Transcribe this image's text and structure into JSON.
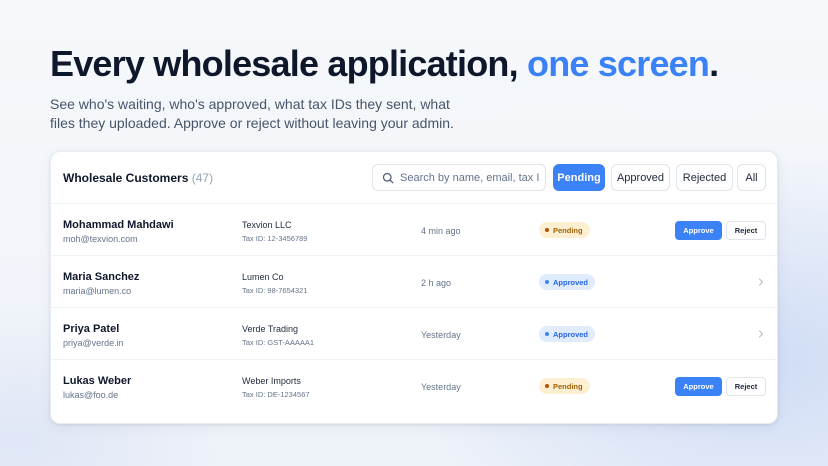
{
  "hero": {
    "title_main": "Every wholesale application, ",
    "title_accent": "one screen",
    "title_end": ".",
    "subtitle": "See who's waiting, who's approved, what tax IDs they sent, what files they uploaded. Approve or reject without leaving your admin.",
    "accent_color": "#3b82f6"
  },
  "panel": {
    "title": "Wholesale Customers",
    "count": "(47)",
    "search": {
      "placeholder": "Search by name, email, tax ID...",
      "value": "",
      "icon": "search-icon"
    },
    "filters": [
      {
        "label": "Pending",
        "active": true
      },
      {
        "label": "Approved",
        "active": false
      },
      {
        "label": "Rejected",
        "active": false
      },
      {
        "label": "All",
        "active": false
      }
    ]
  },
  "customers": [
    {
      "name": "Mohammad Mahdawi",
      "email": "moh@texvion.com",
      "company": "Texvion LLC",
      "tax_id": "Tax ID: 12-3456789",
      "time": "4 min ago",
      "status": "Pending",
      "actions": {
        "approve": "Approve",
        "reject": "Reject"
      }
    },
    {
      "name": "Maria Sanchez",
      "email": "maria@lumen.co",
      "company": "Lumen Co",
      "tax_id": "Tax ID: 98-7654321",
      "time": "2 h ago",
      "status": "Approved",
      "row_icon": "chevron-right-icon"
    },
    {
      "name": "Priya Patel",
      "email": "priya@verde.in",
      "company": "Verde Trading",
      "tax_id": "Tax ID: GST-AAAAA1",
      "time": "Yesterday",
      "status": "Approved",
      "row_icon": "chevron-right-icon"
    },
    {
      "name": "Lukas Weber",
      "email": "lukas@foo.de",
      "company": "Weber Imports",
      "tax_id": "Tax ID: DE-1234567",
      "time": "Yesterday",
      "status": "Pending",
      "actions": {
        "approve": "Approve",
        "reject": "Reject"
      }
    }
  ],
  "colors": {
    "pending_bg": "#fdf0d2",
    "pending_text": "#a16207",
    "approved_bg": "#e0ebfc",
    "approved_text": "#2563eb",
    "primary": "#3b82f6"
  }
}
